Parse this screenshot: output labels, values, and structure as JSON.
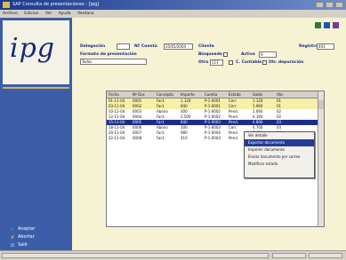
{
  "window": {
    "title": "SAP Consulta de presentaciones - [ipg]"
  },
  "menu": [
    "Archivo",
    "Edicion",
    "Ver",
    "Ayuda",
    "Ventana"
  ],
  "form": {
    "delegation_label": "Delegación",
    "date_label": "Nº Cuenta",
    "date_value": "25/01/2004",
    "client_label": "Cliente",
    "type_label": "Formato de presentación",
    "type_value": "Todos",
    "report_label": "Registro",
    "report_value": "401",
    "lock_label": "Bloqueado",
    "active_label": "Activo",
    "active_value": "0",
    "proc_label": "Otro",
    "proc_value": "CCF",
    "checkbox_a": "C. Contable",
    "checkbox_b": "Otr. depuración"
  },
  "grid": {
    "headers": [
      "Fecha",
      "Nº Doc",
      "Concepto",
      "Importe",
      "Cuenta",
      "Estado",
      "Saldo",
      "Vto."
    ],
    "rows": [
      [
        "01-11-04",
        "0001",
        "Fact.",
        "1.120",
        "P-1-0001",
        "Cerr.",
        "1.120",
        "01"
      ],
      [
        "03-11-04",
        "0002",
        "Fact.",
        "840",
        "P-1-0001",
        "Cerr.",
        "1.960",
        "01"
      ],
      [
        "10-11-04",
        "0003",
        "Abono",
        "300",
        "P-1-0002",
        "Pend.",
        "1.660",
        "02"
      ],
      [
        "12-11-04",
        "0004",
        "Fact.",
        "2.500",
        "P-1-0002",
        "Pend.",
        "4.160",
        "02"
      ],
      [
        "15-11-04",
        "0005",
        "Fact.",
        "640",
        "P-1-0003",
        "Pend.",
        "4.800",
        "03"
      ],
      [
        "18-11-04",
        "0006",
        "Abono",
        "100",
        "P-1-0003",
        "Cerr.",
        "4.700",
        "03"
      ],
      [
        "20-11-04",
        "0007",
        "Fact.",
        "980",
        "P-1-0004",
        "Pend.",
        "5.680",
        "04"
      ],
      [
        "22-11-04",
        "0008",
        "Fact.",
        "410",
        "P-1-0004",
        "Pend.",
        "6.090",
        "04"
      ]
    ]
  },
  "context_menu": [
    "Ver detalle",
    "Exportar documento",
    "Imprimir documento",
    "Enviar documento por correo",
    "Modificar estado"
  ],
  "sidebar": {
    "logo": "ipg",
    "actions": [
      "Aceptar",
      "Abortar",
      "Salir"
    ]
  },
  "colors": {
    "sidebar": "#3c5ea8",
    "main_bg": "#f6f3d5",
    "selection": "#1f2d8a",
    "row_highlight": "#f5f0a8"
  },
  "status": [
    "",
    "",
    ""
  ]
}
